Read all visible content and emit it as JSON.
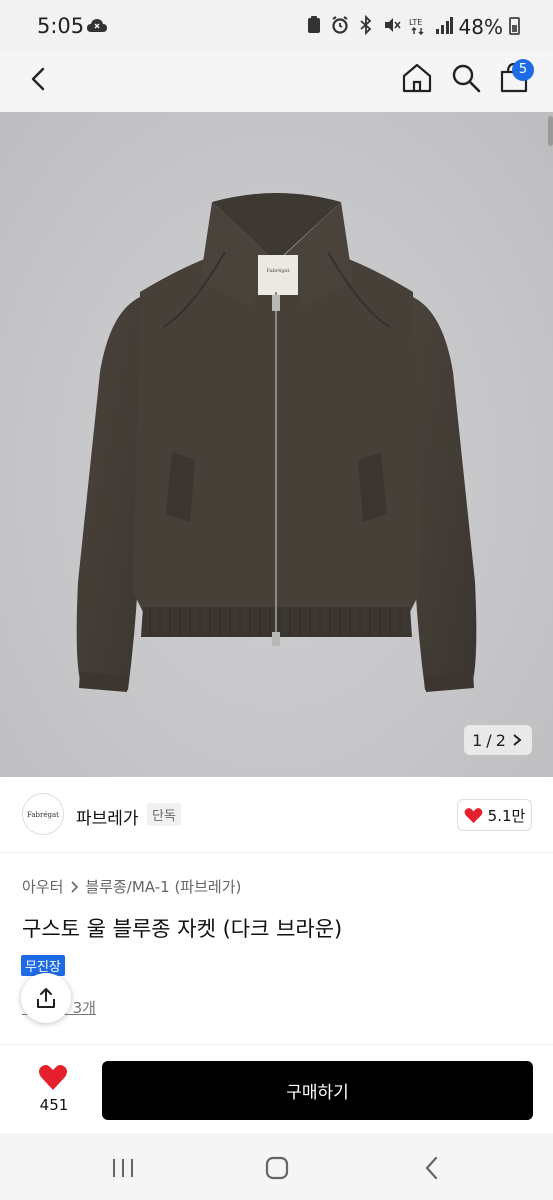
{
  "status_bar": {
    "time": "5:05",
    "battery": "48%",
    "icons": [
      "cloud-icon",
      "clipboard-icon",
      "alarm-icon",
      "bluetooth-icon",
      "mute-icon",
      "lte-icon",
      "signal-icon",
      "battery-icon"
    ]
  },
  "nav": {
    "cart_count": "5",
    "icons": [
      "back-arrow-icon",
      "home-icon",
      "search-icon",
      "cart-icon"
    ]
  },
  "gallery": {
    "counter_current": "1",
    "counter_total": "2",
    "counter_separator": "/"
  },
  "brand": {
    "logo_text": "Fabrégat",
    "name": "파브레가",
    "exclusive_tag": "단독",
    "likes": "5.1만"
  },
  "product": {
    "breadcrumb": [
      "아우터",
      "블루종/MA-1 (파브레가)"
    ],
    "title": "구스토 울 블루종 자켓 (다크 브라운)",
    "badge": "무진장",
    "review_text": "후기 3개"
  },
  "actions": {
    "wishlist_count": "451",
    "buy_label": "구매하기"
  },
  "colors": {
    "accent": "#1e6be6",
    "heart": "#e5202d",
    "buy_button": "#000000"
  }
}
